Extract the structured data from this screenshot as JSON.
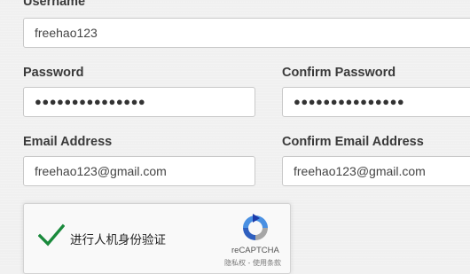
{
  "form": {
    "username_label": "Username",
    "username_value": "freehao123",
    "password_label": "Password",
    "password_value": "●●●●●●●●●●●●●●●",
    "confirm_password_label": "Confirm Password",
    "confirm_password_value": "●●●●●●●●●●●●●●●",
    "email_label": "Email Address",
    "email_value": "freehao123@gmail.com",
    "confirm_email_label": "Confirm Email Address",
    "confirm_email_value": "freehao123@gmail.com"
  },
  "captcha": {
    "text": "进行人机身份验证",
    "brand": "reCAPTCHA",
    "links": "隐私权 - 使用条款",
    "check_color": "#1a8a3c"
  },
  "colors": {
    "background": "#f0f0f0",
    "input_border": "#c9c9c9"
  }
}
